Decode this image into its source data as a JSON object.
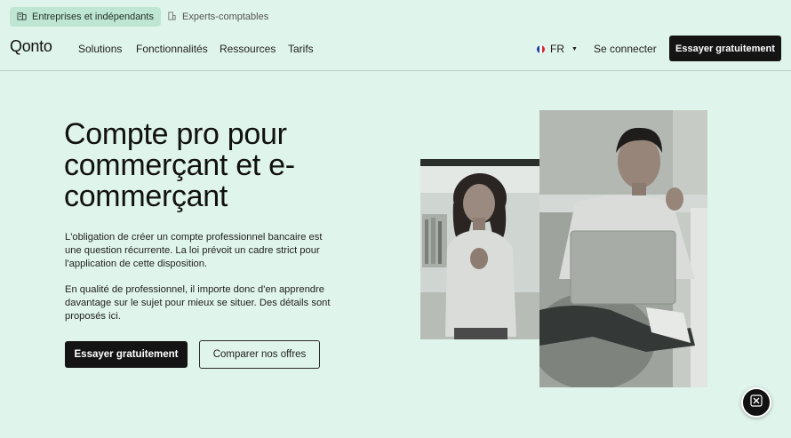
{
  "audience_tabs": [
    {
      "label": "Entreprises et indépendants",
      "active": true,
      "icon": "building-icon"
    },
    {
      "label": "Experts-comptables",
      "active": false,
      "icon": "office-building-icon"
    }
  ],
  "nav": {
    "logo": "Qonto",
    "links": [
      "Solutions",
      "Fonctionnalités",
      "Ressources",
      "Tarifs"
    ],
    "language": "FR",
    "login": "Se connecter",
    "cta": "Essayer gratuitement"
  },
  "hero": {
    "title": "Compte pro pour commerçant et e-commerçant",
    "paragraph1": "L'obligation de créer un compte professionnel bancaire est une question récurrente. La loi prévoit un cadre strict pour l'application de cette disposition.",
    "paragraph2": "En qualité de professionnel, il importe donc d'en apprendre davantage sur le sujet pour mieux se situer. Des détails sont proposés ici.",
    "primary_cta": "Essayer gratuitement",
    "secondary_cta": "Comparer nos offres"
  },
  "colors": {
    "background": "#dff4ea",
    "active_tab": "#bfe6d3",
    "button_dark": "#141414"
  }
}
